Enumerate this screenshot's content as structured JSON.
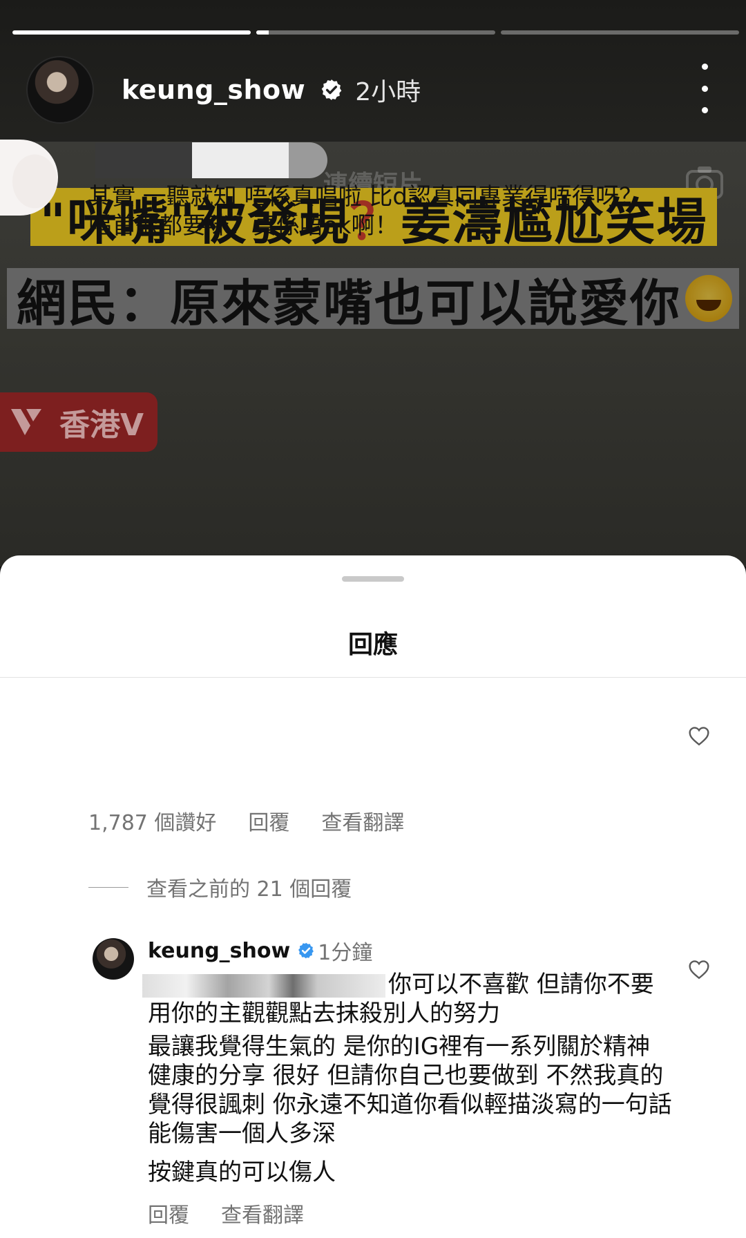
{
  "story": {
    "username": "keung_show",
    "time": "2小時",
    "progress_segments": [
      1,
      0.05,
      0
    ],
    "reel_label": "連續短片",
    "headline_line1_a": "\"咪嘴\"被發現",
    "headline_line1_q": "？",
    "headline_line1_b": "姜濤尷尬笑場",
    "headline_line2": "網民：原來蒙嘴也可以說愛你",
    "channel": "香港V"
  },
  "sheet": {
    "title": "回應",
    "comment": {
      "text": "其實 一聽就知 唔係真唱啦 比d認真同專業得唔得呀？唱首歌都要咪？真係唔ok啊！",
      "likes": "1,787 個讚好",
      "reply": "回覆",
      "translate": "查看翻譯"
    },
    "view_previous": "查看之前的 21 個回覆",
    "reply": {
      "username": "keung_show",
      "time": "1分鐘",
      "para1": "你可以不喜歡 但請你不要用你的主觀觀點去抹殺別人的努力",
      "para2": "最讓我覺得生氣的 是你的IG裡有一系列關於精神健康的分享 很好 但請你自己也要做到 不然我真的覺得很諷刺 你永遠不知道你看似輕描淡寫的一句話能傷害一個人多深",
      "para3": "按鍵真的可以傷人",
      "reply_label": "回覆",
      "translate": "查看翻譯"
    }
  },
  "colors": {
    "headline_yellow": "#e4c220",
    "question_red": "#c0392b",
    "verified_blue": "#3897f0",
    "meta_gray": "#737373"
  },
  "icons": [
    "verified-badge-icon",
    "more-options-icon",
    "back-chevron-icon",
    "camera-icon",
    "heart-icon",
    "laughing-emoji-icon",
    "channel-logo-icon"
  ]
}
